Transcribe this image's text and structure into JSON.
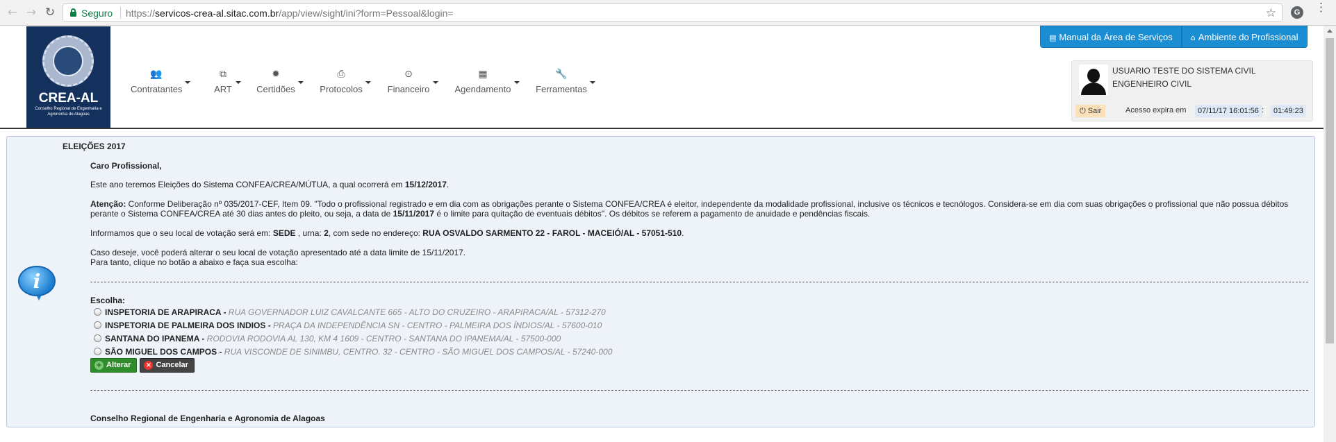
{
  "browser": {
    "secure_label": "Seguro",
    "url_scheme": "https://",
    "url_host": "servicos-crea-al.sitac.com.br",
    "url_path": "/app/view/sight/ini?form=Pessoal&login=",
    "back_icon": "back-arrow-icon",
    "forward_icon": "forward-arrow-icon",
    "reload_icon": "reload-icon",
    "bookmark_icon": "star-icon",
    "extension_letter": "G",
    "menu_icon": "three-dots-icon"
  },
  "logo": {
    "brand": "CREA-AL",
    "subtitle": "Conselho Regional de Engenharia e Agronomia de Alagoas"
  },
  "top_buttons": [
    {
      "label": "Manual da Área de Serviços",
      "icon": "book-icon"
    },
    {
      "label": "Ambiente do Profissional",
      "icon": "home-icon"
    }
  ],
  "menu": [
    {
      "label": "Contratantes",
      "icon": "users-icon",
      "glyph": "👥"
    },
    {
      "label": "ART",
      "icon": "copy-icon",
      "glyph": "⧉"
    },
    {
      "label": "Certidões",
      "icon": "certificate-icon",
      "glyph": "✹"
    },
    {
      "label": "Protocolos",
      "icon": "inbox-icon",
      "glyph": "⎙"
    },
    {
      "label": "Financeiro",
      "icon": "money-icon",
      "glyph": "⊙"
    },
    {
      "label": "Agendamento",
      "icon": "calendar-icon",
      "glyph": "▦"
    },
    {
      "label": "Ferramentas",
      "icon": "wrench-icon",
      "glyph": "🔧"
    }
  ],
  "user": {
    "name": "USUARIO TESTE DO SISTEMA CIVIL",
    "role": "ENGENHEIRO CIVIL",
    "logout_label": "Sair",
    "access_label": "Acesso expira em",
    "access_date": "07/11/17 16:01:56",
    "access_sep": ":",
    "access_time": "01:49:23"
  },
  "content": {
    "title": "ELEIÇÕES 2017",
    "greeting": "Caro Profissional,",
    "p1_pre": "Este ano teremos Eleições do Sistema CONFEA/CREA/MÚTUA, a qual ocorrerá em ",
    "p1_date": "15/12/2017",
    "p1_post": ".",
    "p2_label": "Atenção:",
    "p2_text_a": " Conforme Deliberação nº 035/2017-CEF, Item 09. \"Todo o profissional registrado e em dia com as obrigações perante o Sistema CONFEA/CREA é eleitor, independente da modalidade profissional, inclusive os técnicos e tecnólogos. Considera-se em dia com suas obrigações o profissional que não possua débitos perante o Sistema CONFEA/CREA até 30 dias antes do pleito, ou seja, a data de ",
    "p2_date": "15/11/2017",
    "p2_text_b": " é o limite para quitação de eventuais débitos\". Os débitos se referem a pagamento de anuidade e pendências fiscais.",
    "p3_pre": "Informamos que o seu local de votação será em: ",
    "p3_local": "SEDE",
    "p3_mid1": " , urna: ",
    "p3_urna": "2",
    "p3_mid2": ", com sede no endereço: ",
    "p3_addr": "RUA OSVALDO SARMENTO 22 - FAROL - MACEIÓ/AL - 57051-510",
    "p3_post": ".",
    "p4_line1": "Caso deseje, você poderá alterar o seu local de votação apresentado até a data limite de 15/11/2017.",
    "p4_line2": "Para tanto, clique no botão a abaixo e faça sua escolha:",
    "choose_label": "Escolha:",
    "options": [
      {
        "name": "INSPETORIA DE ARAPIRACA - ",
        "addr": "RUA GOVERNADOR LUIZ CAVALCANTE 665 - ALTO DO CRUZEIRO - ARAPIRACA/AL - 57312-270"
      },
      {
        "name": "INSPETORIA DE PALMEIRA DOS INDIOS - ",
        "addr": "PRAÇA DA INDEPENDÊNCIA SN - CENTRO - PALMEIRA DOS ÍNDIOS/AL - 57600-010"
      },
      {
        "name": "SANTANA DO IPANEMA - ",
        "addr": "RODOVIA RODOVIA AL 130, KM 4 1609 - CENTRO - SANTANA DO IPANEMA/AL - 57500-000"
      },
      {
        "name": "SÃO MIGUEL DOS CAMPOS - ",
        "addr": "RUA VISCONDE DE SINIMBU, CENTRO. 32 - CENTRO - SÃO MIGUEL DOS CAMPOS/AL - 57240-000"
      }
    ],
    "confirm_label": "Alterar",
    "cancel_label": "Cancelar",
    "footer": "Conselho Regional de Engenharia e Agronomia de Alagoas"
  }
}
